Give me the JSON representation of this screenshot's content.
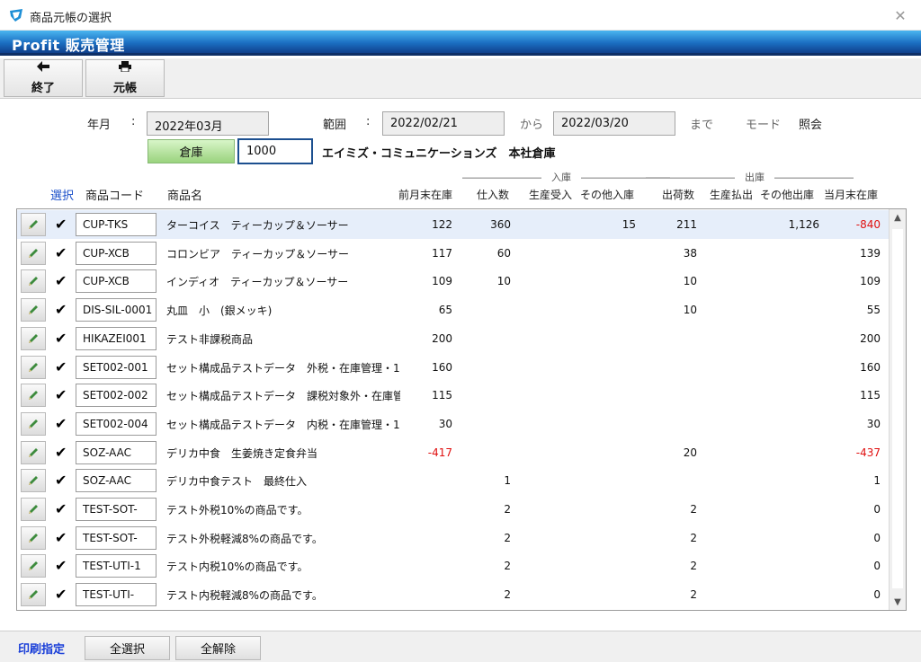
{
  "window": {
    "title": "商品元帳の選択",
    "app_name": "Profit 販売管理"
  },
  "toolbar": {
    "exit": {
      "icon": "arrow-left-icon",
      "label": "終了"
    },
    "ledger": {
      "icon": "printer-icon",
      "label": "元帳"
    }
  },
  "filters": {
    "year_month_label": "年月",
    "colon": ":",
    "year_month_value": "2022年03月",
    "range_label": "範囲",
    "range_from": "2022/02/21",
    "range_from_suffix": "から",
    "range_to": "2022/03/20",
    "range_to_suffix": "まで",
    "mode_label": "モード",
    "mode_value": "照会",
    "warehouse_button": "倉庫",
    "warehouse_code": "1000",
    "warehouse_name": "エイミズ・コミュニケーションズ　本社倉庫"
  },
  "groups": {
    "receipt": "――――――――　入庫　―――――――――",
    "shipment": "―――――――――　出庫　――――――――"
  },
  "columns": {
    "select": "選択",
    "product_code": "商品コード",
    "product_name": "商品名",
    "prev_stock": "前月末在庫",
    "purchase_in": "仕入数",
    "production_in": "生産受入",
    "other_in": "その他入庫",
    "shipped": "出荷数",
    "production_out": "生産払出",
    "other_out": "その他出庫",
    "end_stock": "当月末在庫"
  },
  "rows": [
    {
      "code": "CUP-TKS",
      "name": "ターコイス　ティーカップ＆ソーサー",
      "prev": "122",
      "purchase": "360",
      "prod_in": "",
      "other_in": "15",
      "shipped": "211",
      "prod_out": "",
      "other_out": "1,126",
      "end": "-840",
      "checked": "✔"
    },
    {
      "code": "CUP-XCB",
      "name": "コロンビア　ティーカップ＆ソーサー",
      "prev": "117",
      "purchase": "60",
      "prod_in": "",
      "other_in": "",
      "shipped": "38",
      "prod_out": "",
      "other_out": "",
      "end": "139",
      "checked": "✔"
    },
    {
      "code": "CUP-XCB",
      "name": "インディオ　ティーカップ＆ソーサー",
      "prev": "109",
      "purchase": "10",
      "prod_in": "",
      "other_in": "",
      "shipped": "10",
      "prod_out": "",
      "other_out": "",
      "end": "109",
      "checked": "✔"
    },
    {
      "code": "DIS-SIL-0001",
      "name": "丸皿　小　(銀メッキ)",
      "prev": "65",
      "purchase": "",
      "prod_in": "",
      "other_in": "",
      "shipped": "10",
      "prod_out": "",
      "other_out": "",
      "end": "55",
      "checked": "✔"
    },
    {
      "code": "HIKAZEI001",
      "name": "テスト非課税商品",
      "prev": "200",
      "purchase": "",
      "prod_in": "",
      "other_in": "",
      "shipped": "",
      "prod_out": "",
      "other_out": "",
      "end": "200",
      "checked": "✔"
    },
    {
      "code": "SET002-001",
      "name": "セット構成品テストデータ　外税・在庫管理・1",
      "prev": "160",
      "purchase": "",
      "prod_in": "",
      "other_in": "",
      "shipped": "",
      "prod_out": "",
      "other_out": "",
      "end": "160",
      "checked": "✔"
    },
    {
      "code": "SET002-002",
      "name": "セット構成品テストデータ　課税対象外・在庫管",
      "prev": "115",
      "purchase": "",
      "prod_in": "",
      "other_in": "",
      "shipped": "",
      "prod_out": "",
      "other_out": "",
      "end": "115",
      "checked": "✔"
    },
    {
      "code": "SET002-004",
      "name": "セット構成品テストデータ　内税・在庫管理・1",
      "prev": "30",
      "purchase": "",
      "prod_in": "",
      "other_in": "",
      "shipped": "",
      "prod_out": "",
      "other_out": "",
      "end": "30",
      "checked": "✔"
    },
    {
      "code": "SOZ-AAC",
      "name": "デリカ中食　生姜焼き定食弁当",
      "prev": "-417",
      "purchase": "",
      "prod_in": "",
      "other_in": "",
      "shipped": "20",
      "prod_out": "",
      "other_out": "",
      "end": "-437",
      "checked": "✔"
    },
    {
      "code": "SOZ-AAC",
      "name": "デリカ中食テスト　最終仕入",
      "prev": "",
      "purchase": "1",
      "prod_in": "",
      "other_in": "",
      "shipped": "",
      "prod_out": "",
      "other_out": "",
      "end": "1",
      "checked": "✔"
    },
    {
      "code": "TEST-SOT-",
      "name": "テスト外税10%の商品です。",
      "prev": "",
      "purchase": "2",
      "prod_in": "",
      "other_in": "",
      "shipped": "2",
      "prod_out": "",
      "other_out": "",
      "end": "0",
      "checked": "✔"
    },
    {
      "code": "TEST-SOT-",
      "name": "テスト外税軽減8%の商品です。",
      "prev": "",
      "purchase": "2",
      "prod_in": "",
      "other_in": "",
      "shipped": "2",
      "prod_out": "",
      "other_out": "",
      "end": "0",
      "checked": "✔"
    },
    {
      "code": "TEST-UTI-1",
      "name": "テスト内税10%の商品です。",
      "prev": "",
      "purchase": "2",
      "prod_in": "",
      "other_in": "",
      "shipped": "2",
      "prod_out": "",
      "other_out": "",
      "end": "0",
      "checked": "✔"
    },
    {
      "code": "TEST-UTI-",
      "name": "テスト内税軽減8%の商品です。",
      "prev": "",
      "purchase": "2",
      "prod_in": "",
      "other_in": "",
      "shipped": "2",
      "prod_out": "",
      "other_out": "",
      "end": "0",
      "checked": "✔"
    }
  ],
  "footer": {
    "print_label": "印刷指定",
    "select_all": "全選択",
    "deselect_all": "全解除"
  },
  "colors": {
    "banner": "#1b6fc2",
    "negative": "#e01010",
    "link_blue": "#1a4fc9",
    "warehouse_green": "#9ad37e"
  }
}
